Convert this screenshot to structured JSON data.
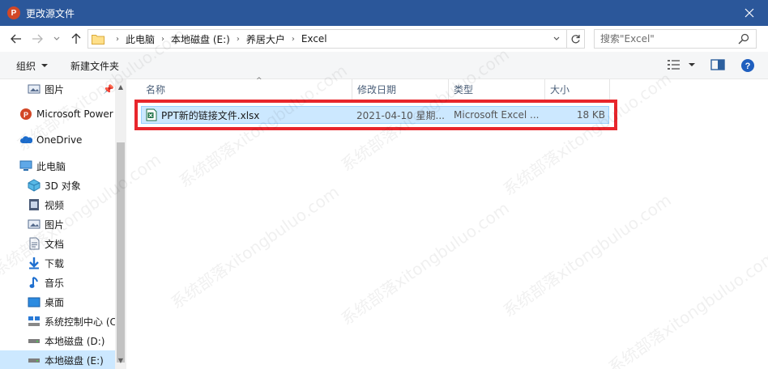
{
  "window": {
    "title": "更改源文件",
    "app_icon_letter": "P"
  },
  "address": {
    "crumbs": [
      "此电脑",
      "本地磁盘 (E:)",
      "养居大户",
      "Excel"
    ]
  },
  "search": {
    "placeholder": "搜索\"Excel\""
  },
  "toolbar": {
    "organize_label": "组织",
    "new_folder_label": "新建文件夹"
  },
  "nav": {
    "items": [
      {
        "label": "图片",
        "icon": "pictures-icon"
      },
      {
        "label": "Microsoft Power",
        "icon": "powerpoint-icon"
      },
      {
        "label": "OneDrive",
        "icon": "onedrive-icon"
      },
      {
        "label": "此电脑",
        "icon": "this-pc-icon"
      },
      {
        "label": "3D 对象",
        "icon": "3d-objects-icon"
      },
      {
        "label": "视频",
        "icon": "videos-icon"
      },
      {
        "label": "图片",
        "icon": "pictures-icon"
      },
      {
        "label": "文档",
        "icon": "documents-icon"
      },
      {
        "label": "下载",
        "icon": "downloads-icon"
      },
      {
        "label": "音乐",
        "icon": "music-icon"
      },
      {
        "label": "桌面",
        "icon": "desktop-icon"
      },
      {
        "label": "系统控制中心 (C",
        "icon": "drive-icon"
      },
      {
        "label": "本地磁盘 (D:)",
        "icon": "drive-icon"
      },
      {
        "label": "本地磁盘 (E:)",
        "icon": "drive-icon"
      }
    ]
  },
  "columns": {
    "name": "名称",
    "modified": "修改日期",
    "type": "类型",
    "size": "大小"
  },
  "files": [
    {
      "name": "PPT新的链接文件.xlsx",
      "modified": "2021-04-10 星期...",
      "type": "Microsoft Excel ...",
      "size": "18 KB",
      "icon": "excel-file-icon"
    }
  ],
  "watermark": "系统部落xitongbuluo.com",
  "colors": {
    "titlebar": "#2b579a",
    "selection": "#cce8ff",
    "highlight": "#e8262c"
  }
}
